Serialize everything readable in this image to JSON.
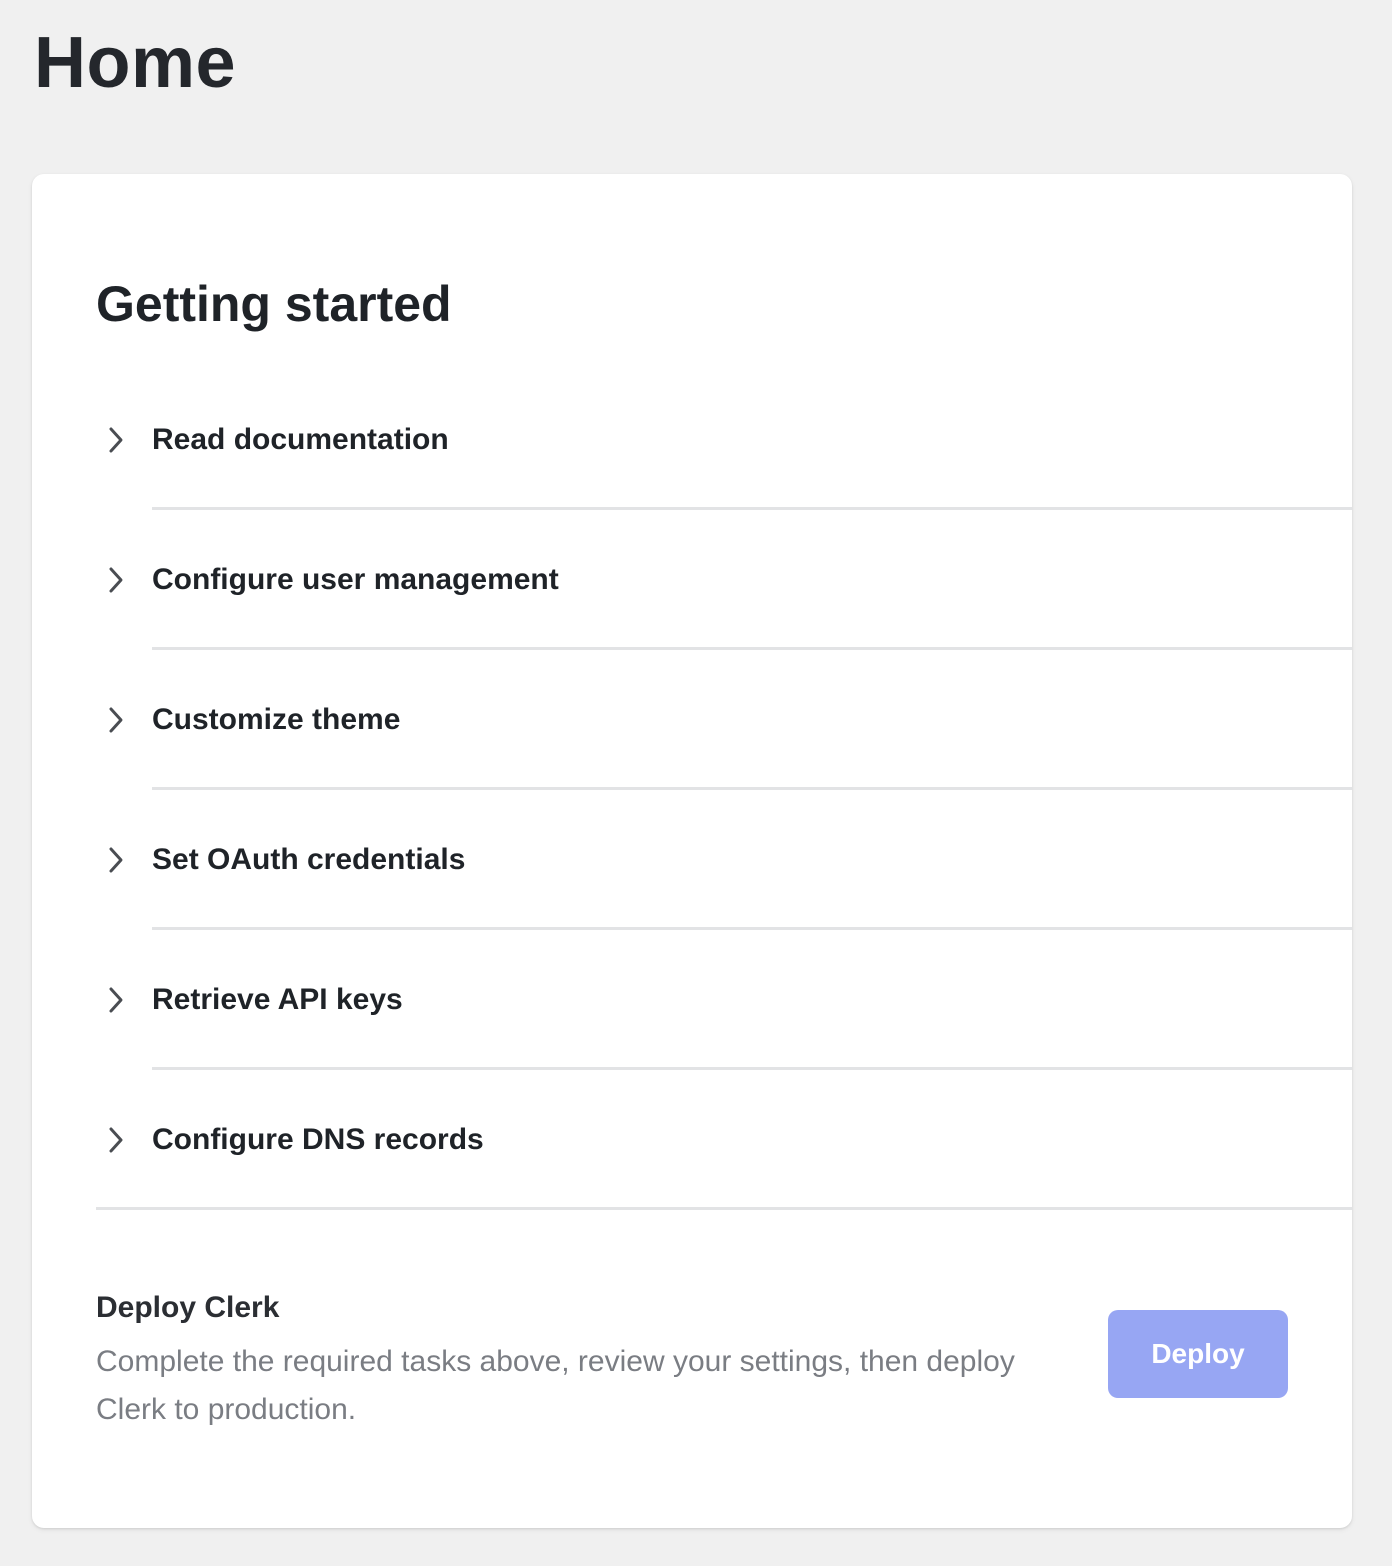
{
  "page": {
    "title": "Home"
  },
  "getting_started": {
    "title": "Getting started",
    "tasks": [
      {
        "label": "Read documentation",
        "icon": "chevron-right-icon"
      },
      {
        "label": "Configure user management",
        "icon": "chevron-right-icon"
      },
      {
        "label": "Customize theme",
        "icon": "chevron-right-icon"
      },
      {
        "label": "Set OAuth credentials",
        "icon": "chevron-right-icon"
      },
      {
        "label": "Retrieve API keys",
        "icon": "chevron-right-icon"
      },
      {
        "label": "Configure DNS records",
        "icon": "chevron-right-icon"
      }
    ]
  },
  "deploy": {
    "title": "Deploy Clerk",
    "description": "Complete the required tasks above, review your settings, then deploy Clerk to production.",
    "button_label": "Deploy",
    "button_disabled": true
  },
  "colors": {
    "page_background": "#f0f0f0",
    "card_background": "#ffffff",
    "deploy_button": "#97a6f3",
    "divider": "#e2e3e5",
    "muted_text": "#7a7d83"
  }
}
